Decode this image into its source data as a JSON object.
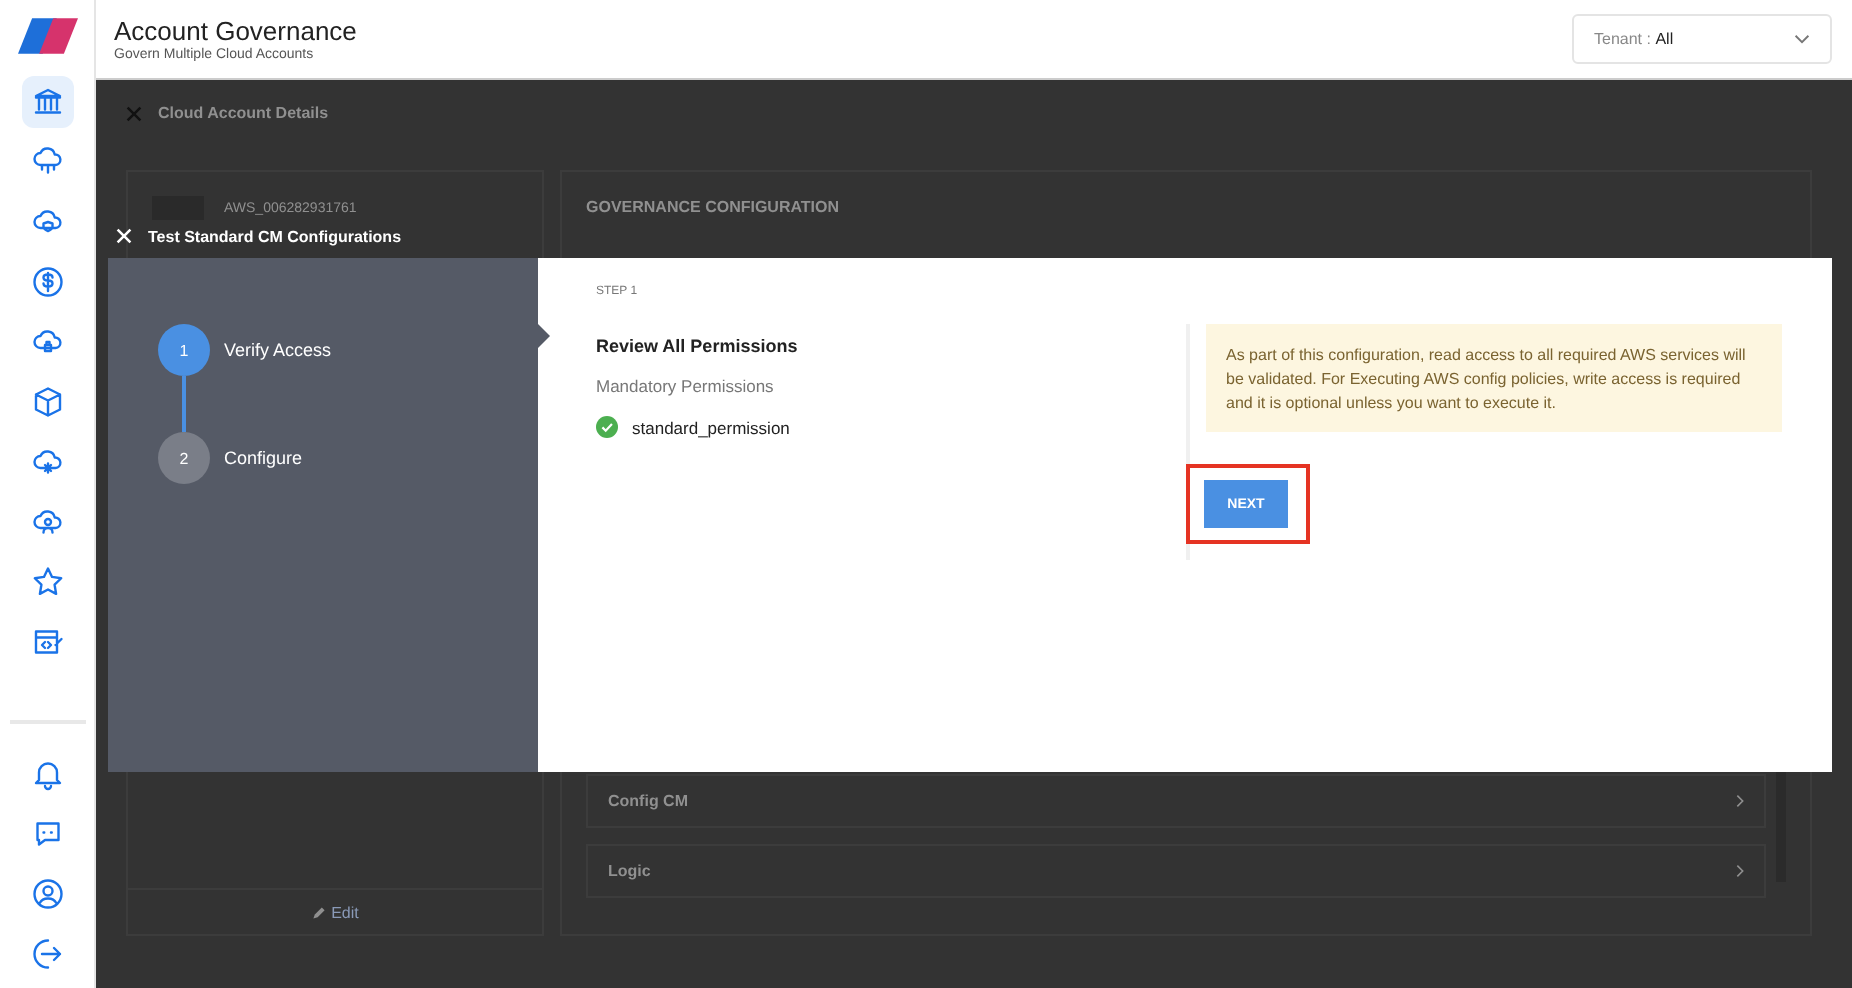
{
  "app_header": {
    "title": "Account Governance",
    "subtitle": "Govern Multiple Cloud Accounts",
    "tenant": {
      "label": "Tenant :",
      "value": "All"
    }
  },
  "sidebar": {
    "top_items": [
      {
        "selected": true
      },
      {
        "selected": false
      },
      {
        "selected": false
      },
      {
        "selected": false
      },
      {
        "selected": false
      },
      {
        "selected": false
      },
      {
        "selected": false
      },
      {
        "selected": false
      },
      {
        "selected": false
      },
      {
        "selected": false
      }
    ],
    "bottom_items": [
      {
        "selected": false
      },
      {
        "selected": false
      },
      {
        "selected": false
      },
      {
        "selected": false
      }
    ]
  },
  "background_page": {
    "title": "Cloud Account Details",
    "account_id": "AWS_006282931761",
    "edit_label": "Edit",
    "section_title": "GOVERNANCE CONFIGURATION",
    "rows": [
      "Config CM",
      "Logic"
    ]
  },
  "modal": {
    "title": "Test Standard CM Configurations",
    "steps": [
      {
        "number": "1",
        "label": "Verify Access",
        "selected": true
      },
      {
        "number": "2",
        "label": "Configure",
        "selected": false
      }
    ],
    "step_caption": "STEP 1",
    "heading": "Review All Permissions",
    "subheading": "Mandatory Permissions",
    "permissions": [
      {
        "name": "standard_permission",
        "checked": true
      }
    ],
    "note": "As part of this configuration, read access to all required AWS services will be validated. For Executing AWS config policies, write access is required and it is optional unless you want to execute it.",
    "next_button": {
      "label": "NEXT",
      "highlighted": true
    }
  }
}
